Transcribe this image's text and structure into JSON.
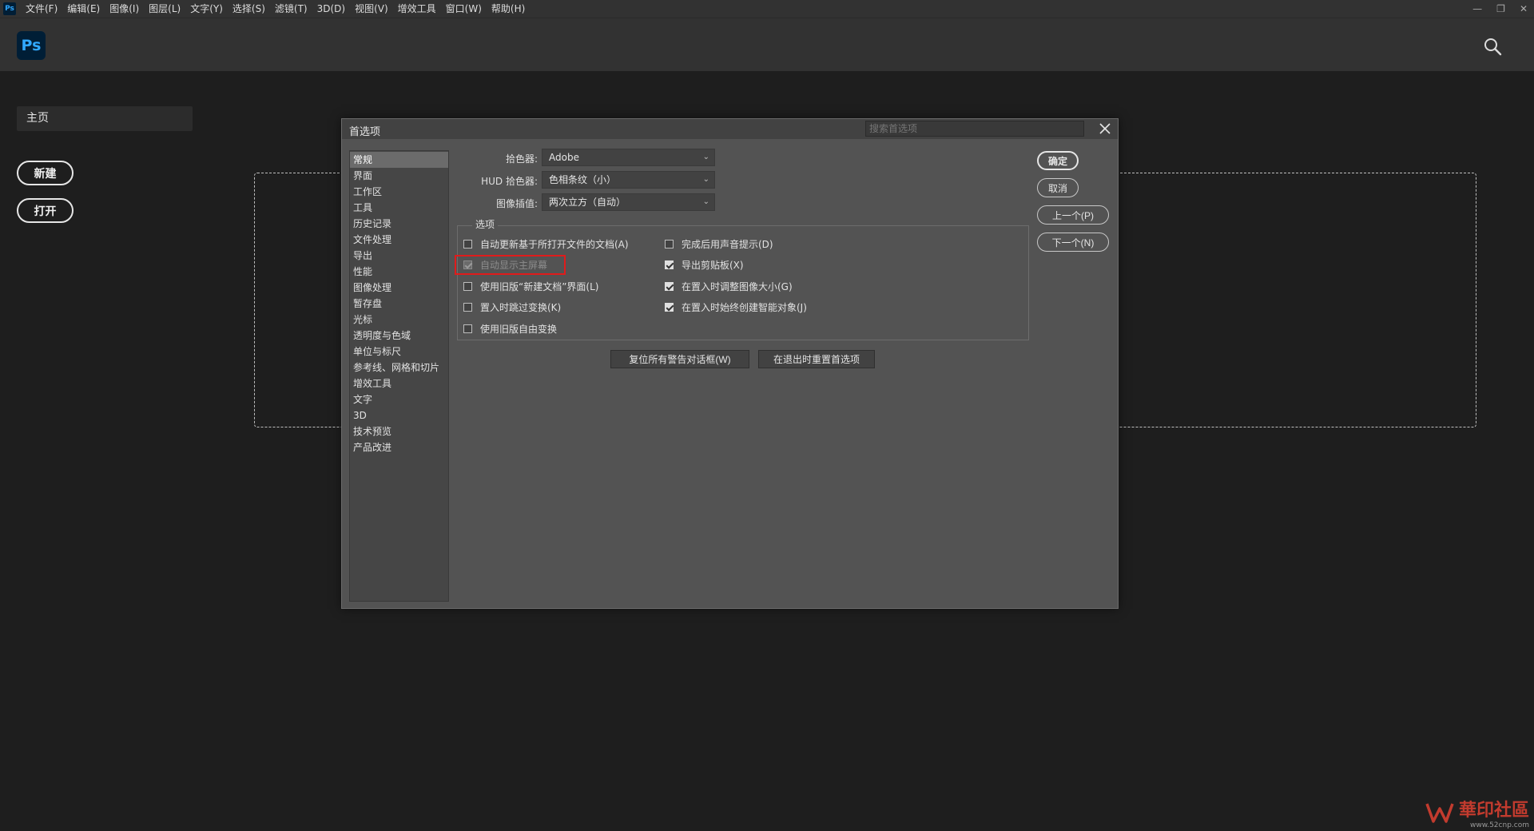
{
  "menubar": {
    "items": [
      "文件(F)",
      "编辑(E)",
      "图像(I)",
      "图层(L)",
      "文字(Y)",
      "选择(S)",
      "滤镜(T)",
      "3D(D)",
      "视图(V)",
      "增效工具",
      "窗口(W)",
      "帮助(H)"
    ],
    "app_icon_label": "Ps"
  },
  "header": {
    "logo_text": "Ps"
  },
  "home": {
    "tab_label": "主页",
    "new_label": "新建",
    "open_label": "打开"
  },
  "dialog": {
    "title": "首选项",
    "search_placeholder": "搜索首选项",
    "nav_items": [
      "常规",
      "界面",
      "工作区",
      "工具",
      "历史记录",
      "文件处理",
      "导出",
      "性能",
      "图像处理",
      "暂存盘",
      "光标",
      "透明度与色域",
      "单位与标尺",
      "参考线、网格和切片",
      "增效工具",
      "文字",
      "3D",
      "技术预览",
      "产品改进"
    ],
    "selected_nav": 0,
    "color_picker_label": "拾色器:",
    "color_picker_value": "Adobe",
    "hud_picker_label": "HUD 拾色器:",
    "hud_picker_value": "色相条纹（小）",
    "interp_label": "图像插值:",
    "interp_value": "两次立方（自动）",
    "options_label": "选项",
    "options": [
      {
        "label": "自动更新基于所打开文件的文档(A)",
        "checked": false,
        "disabled": false
      },
      {
        "label": "完成后用声音提示(D)",
        "checked": false,
        "disabled": false
      },
      {
        "label": "自动显示主屏幕",
        "checked": true,
        "disabled": true
      },
      {
        "label": "导出剪贴板(X)",
        "checked": true,
        "disabled": false
      },
      {
        "label": "使用旧版“新建文档”界面(L)",
        "checked": false,
        "disabled": false
      },
      {
        "label": "在置入时调整图像大小(G)",
        "checked": true,
        "disabled": false
      },
      {
        "label": "置入时跳过变换(K)",
        "checked": false,
        "disabled": false
      },
      {
        "label": "在置入时始终创建智能对象(J)",
        "checked": true,
        "disabled": false
      },
      {
        "label": "使用旧版自由变换",
        "checked": false,
        "disabled": false
      }
    ],
    "reset_warnings_label": "复位所有警告对话框(W)",
    "reset_prefs_label": "在退出时重置首选项",
    "ok_label": "确定",
    "cancel_label": "取消",
    "prev_label": "上一个(P)",
    "next_label": "下一个(N)"
  },
  "watermark": {
    "text": "華印社區",
    "url_text": "www.52cnp.com"
  },
  "colors": {
    "accent": "#31a8ff",
    "logo_bg": "#001e36",
    "highlight": "#e01b1b",
    "watermark": "#c23b2e"
  }
}
